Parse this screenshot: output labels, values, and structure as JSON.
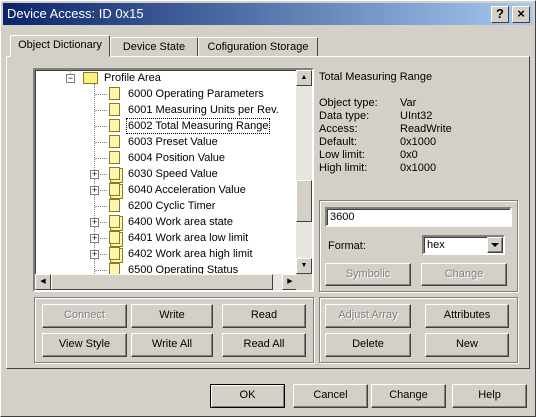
{
  "window": {
    "title": "Device Access: ID 0x15"
  },
  "titlebar_buttons": {
    "help": "?",
    "close": "×"
  },
  "tabs": [
    {
      "label": "Object Dictionary",
      "active": true
    },
    {
      "label": "Device State",
      "active": false
    },
    {
      "label": "Cofiguration Storage",
      "active": false
    }
  ],
  "tree": {
    "items": [
      {
        "label": "Profile Area",
        "icon": "folder-icon",
        "expander": "−"
      },
      {
        "label": "6000 Operating Parameters",
        "icon": "document-icon"
      },
      {
        "label": "6001 Measuring Units per Rev.",
        "icon": "document-icon"
      },
      {
        "label": "6002 Total Measuring Range",
        "icon": "document-icon",
        "selected": true
      },
      {
        "label": "6003 Preset Value",
        "icon": "document-icon"
      },
      {
        "label": "6004 Position Value",
        "icon": "document-icon"
      },
      {
        "label": "6030 Speed Value",
        "icon": "document-stack-icon",
        "expander": "+"
      },
      {
        "label": "6040 Acceleration Value",
        "icon": "document-stack-icon",
        "expander": "+"
      },
      {
        "label": "6200 Cyclic Timer",
        "icon": "document-icon"
      },
      {
        "label": "6400 Work area state",
        "icon": "document-stack-icon",
        "expander": "+"
      },
      {
        "label": "6401 Work area low limit",
        "icon": "document-stack-icon",
        "expander": "+"
      },
      {
        "label": "6402 Work area high limit",
        "icon": "document-stack-icon",
        "expander": "+"
      },
      {
        "label": "6500 Operating Status",
        "icon": "document-icon"
      }
    ]
  },
  "object_info": {
    "title": "Total Measuring Range",
    "rows": [
      {
        "key": "Object type:",
        "value": "Var"
      },
      {
        "key": "Data type:",
        "value": "UInt32"
      },
      {
        "key": "Access:",
        "value": "ReadWrite"
      },
      {
        "key": "Default:",
        "value": "0x1000"
      },
      {
        "key": "Low limit:",
        "value": "0x0"
      },
      {
        "key": "High limit:",
        "value": "0x1000"
      }
    ]
  },
  "value_editor": {
    "value": "3600",
    "format_label": "Format:",
    "format_selected": "hex",
    "symbolic_label": "Symbolic",
    "change_label": "Change"
  },
  "communication_buttons": {
    "connect": "Connect",
    "write": "Write",
    "read": "Read",
    "view_style": "View Style",
    "write_all": "Write All",
    "read_all": "Read All"
  },
  "array_buttons": {
    "adjust_array": "Adjust Array",
    "attributes": "Attributes",
    "delete": "Delete",
    "new": "New"
  },
  "dialog_buttons": {
    "ok": "OK",
    "cancel": "Cancel",
    "change": "Change",
    "help": "Help"
  },
  "colors": {
    "titlebar_start": "#0a246a",
    "titlebar_end": "#a6caf0",
    "face": "#d4d0c8",
    "disabled_text": "#808080"
  }
}
